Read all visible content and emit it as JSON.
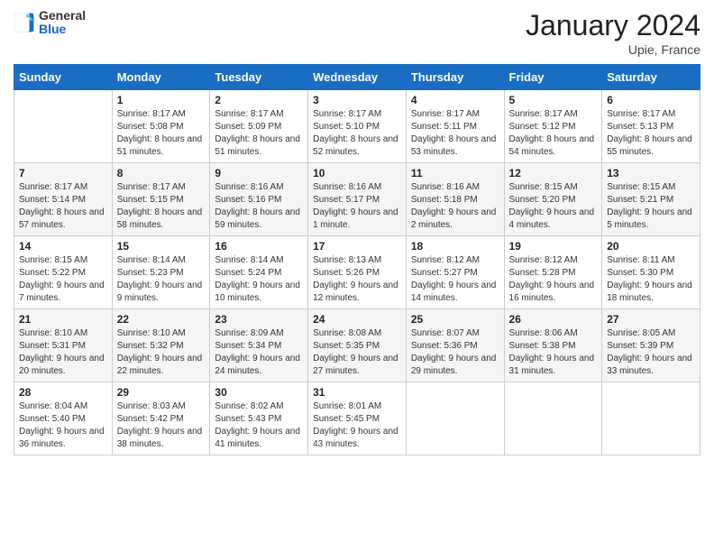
{
  "header": {
    "logo": {
      "general": "General",
      "blue": "Blue"
    },
    "title": "January 2024",
    "location": "Upie, France"
  },
  "weekdays": [
    "Sunday",
    "Monday",
    "Tuesday",
    "Wednesday",
    "Thursday",
    "Friday",
    "Saturday"
  ],
  "weeks": [
    [
      {
        "day": null
      },
      {
        "day": "1",
        "sunrise": "Sunrise: 8:17 AM",
        "sunset": "Sunset: 5:08 PM",
        "daylight": "Daylight: 8 hours and 51 minutes."
      },
      {
        "day": "2",
        "sunrise": "Sunrise: 8:17 AM",
        "sunset": "Sunset: 5:09 PM",
        "daylight": "Daylight: 8 hours and 51 minutes."
      },
      {
        "day": "3",
        "sunrise": "Sunrise: 8:17 AM",
        "sunset": "Sunset: 5:10 PM",
        "daylight": "Daylight: 8 hours and 52 minutes."
      },
      {
        "day": "4",
        "sunrise": "Sunrise: 8:17 AM",
        "sunset": "Sunset: 5:11 PM",
        "daylight": "Daylight: 8 hours and 53 minutes."
      },
      {
        "day": "5",
        "sunrise": "Sunrise: 8:17 AM",
        "sunset": "Sunset: 5:12 PM",
        "daylight": "Daylight: 8 hours and 54 minutes."
      },
      {
        "day": "6",
        "sunrise": "Sunrise: 8:17 AM",
        "sunset": "Sunset: 5:13 PM",
        "daylight": "Daylight: 8 hours and 55 minutes."
      }
    ],
    [
      {
        "day": "7",
        "sunrise": "Sunrise: 8:17 AM",
        "sunset": "Sunset: 5:14 PM",
        "daylight": "Daylight: 8 hours and 57 minutes."
      },
      {
        "day": "8",
        "sunrise": "Sunrise: 8:17 AM",
        "sunset": "Sunset: 5:15 PM",
        "daylight": "Daylight: 8 hours and 58 minutes."
      },
      {
        "day": "9",
        "sunrise": "Sunrise: 8:16 AM",
        "sunset": "Sunset: 5:16 PM",
        "daylight": "Daylight: 8 hours and 59 minutes."
      },
      {
        "day": "10",
        "sunrise": "Sunrise: 8:16 AM",
        "sunset": "Sunset: 5:17 PM",
        "daylight": "Daylight: 9 hours and 1 minute."
      },
      {
        "day": "11",
        "sunrise": "Sunrise: 8:16 AM",
        "sunset": "Sunset: 5:18 PM",
        "daylight": "Daylight: 9 hours and 2 minutes."
      },
      {
        "day": "12",
        "sunrise": "Sunrise: 8:15 AM",
        "sunset": "Sunset: 5:20 PM",
        "daylight": "Daylight: 9 hours and 4 minutes."
      },
      {
        "day": "13",
        "sunrise": "Sunrise: 8:15 AM",
        "sunset": "Sunset: 5:21 PM",
        "daylight": "Daylight: 9 hours and 5 minutes."
      }
    ],
    [
      {
        "day": "14",
        "sunrise": "Sunrise: 8:15 AM",
        "sunset": "Sunset: 5:22 PM",
        "daylight": "Daylight: 9 hours and 7 minutes."
      },
      {
        "day": "15",
        "sunrise": "Sunrise: 8:14 AM",
        "sunset": "Sunset: 5:23 PM",
        "daylight": "Daylight: 9 hours and 9 minutes."
      },
      {
        "day": "16",
        "sunrise": "Sunrise: 8:14 AM",
        "sunset": "Sunset: 5:24 PM",
        "daylight": "Daylight: 9 hours and 10 minutes."
      },
      {
        "day": "17",
        "sunrise": "Sunrise: 8:13 AM",
        "sunset": "Sunset: 5:26 PM",
        "daylight": "Daylight: 9 hours and 12 minutes."
      },
      {
        "day": "18",
        "sunrise": "Sunrise: 8:12 AM",
        "sunset": "Sunset: 5:27 PM",
        "daylight": "Daylight: 9 hours and 14 minutes."
      },
      {
        "day": "19",
        "sunrise": "Sunrise: 8:12 AM",
        "sunset": "Sunset: 5:28 PM",
        "daylight": "Daylight: 9 hours and 16 minutes."
      },
      {
        "day": "20",
        "sunrise": "Sunrise: 8:11 AM",
        "sunset": "Sunset: 5:30 PM",
        "daylight": "Daylight: 9 hours and 18 minutes."
      }
    ],
    [
      {
        "day": "21",
        "sunrise": "Sunrise: 8:10 AM",
        "sunset": "Sunset: 5:31 PM",
        "daylight": "Daylight: 9 hours and 20 minutes."
      },
      {
        "day": "22",
        "sunrise": "Sunrise: 8:10 AM",
        "sunset": "Sunset: 5:32 PM",
        "daylight": "Daylight: 9 hours and 22 minutes."
      },
      {
        "day": "23",
        "sunrise": "Sunrise: 8:09 AM",
        "sunset": "Sunset: 5:34 PM",
        "daylight": "Daylight: 9 hours and 24 minutes."
      },
      {
        "day": "24",
        "sunrise": "Sunrise: 8:08 AM",
        "sunset": "Sunset: 5:35 PM",
        "daylight": "Daylight: 9 hours and 27 minutes."
      },
      {
        "day": "25",
        "sunrise": "Sunrise: 8:07 AM",
        "sunset": "Sunset: 5:36 PM",
        "daylight": "Daylight: 9 hours and 29 minutes."
      },
      {
        "day": "26",
        "sunrise": "Sunrise: 8:06 AM",
        "sunset": "Sunset: 5:38 PM",
        "daylight": "Daylight: 9 hours and 31 minutes."
      },
      {
        "day": "27",
        "sunrise": "Sunrise: 8:05 AM",
        "sunset": "Sunset: 5:39 PM",
        "daylight": "Daylight: 9 hours and 33 minutes."
      }
    ],
    [
      {
        "day": "28",
        "sunrise": "Sunrise: 8:04 AM",
        "sunset": "Sunset: 5:40 PM",
        "daylight": "Daylight: 9 hours and 36 minutes."
      },
      {
        "day": "29",
        "sunrise": "Sunrise: 8:03 AM",
        "sunset": "Sunset: 5:42 PM",
        "daylight": "Daylight: 9 hours and 38 minutes."
      },
      {
        "day": "30",
        "sunrise": "Sunrise: 8:02 AM",
        "sunset": "Sunset: 5:43 PM",
        "daylight": "Daylight: 9 hours and 41 minutes."
      },
      {
        "day": "31",
        "sunrise": "Sunrise: 8:01 AM",
        "sunset": "Sunset: 5:45 PM",
        "daylight": "Daylight: 9 hours and 43 minutes."
      },
      {
        "day": null
      },
      {
        "day": null
      },
      {
        "day": null
      }
    ]
  ]
}
